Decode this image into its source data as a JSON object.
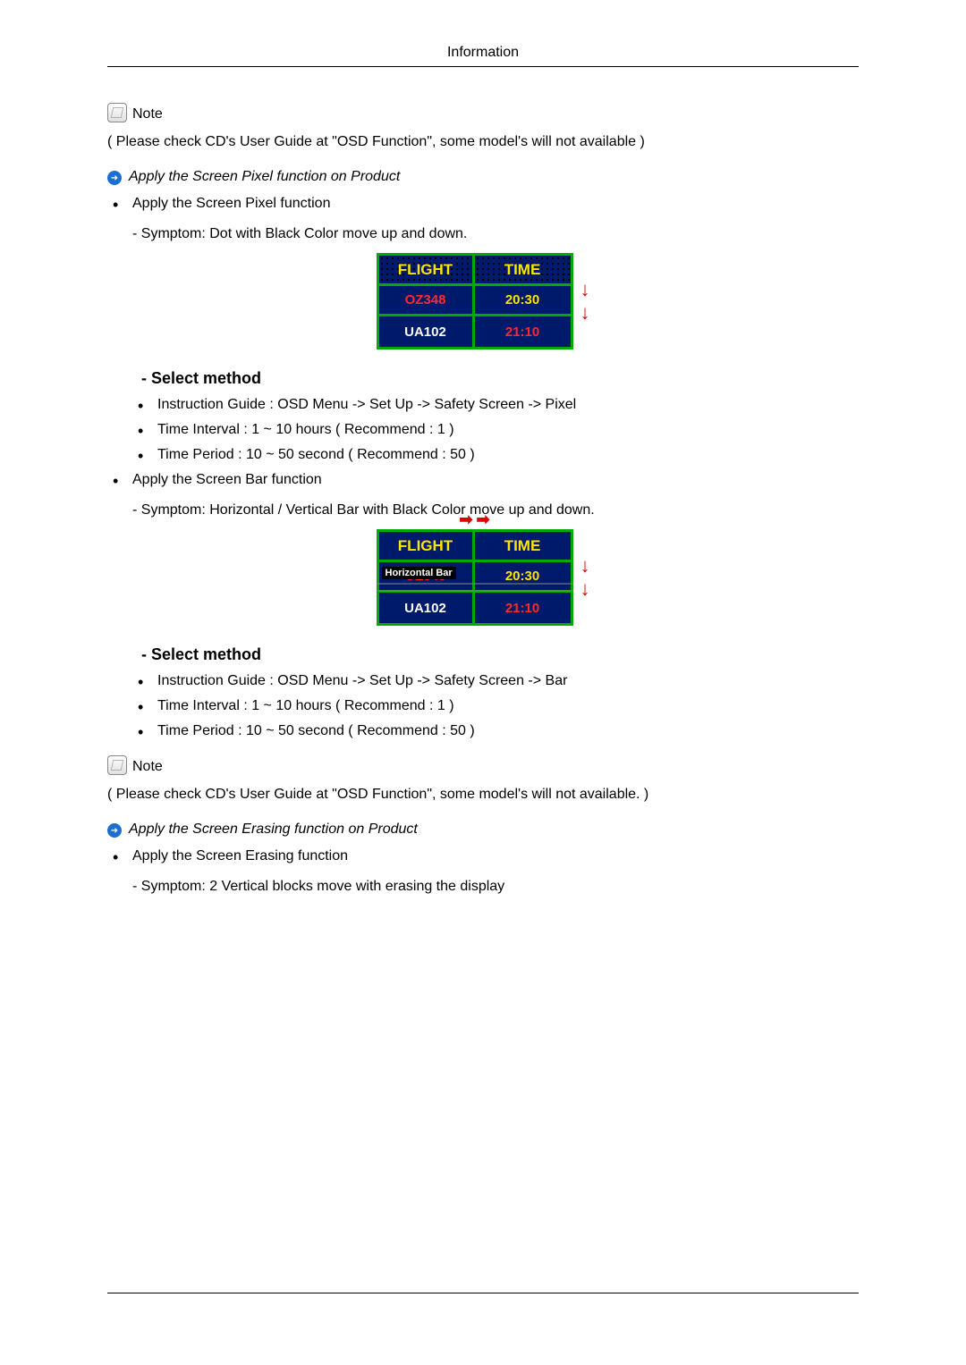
{
  "header": {
    "title": "Information"
  },
  "note1": {
    "label": "Note",
    "text": "( Please check CD's User Guide at \"OSD Function\", some model's will not available )"
  },
  "section_pixel": {
    "arrow_title": "Apply the Screen Pixel function on Product",
    "bullet": "Apply the Screen Pixel function",
    "symptom": "- Symptom: Dot with Black Color move up and down.",
    "select_method": "- Select method",
    "items": [
      "Instruction Guide : OSD Menu -> Set Up -> Safety Screen -> Pixel",
      "Time Interval : 1 ~ 10 hours ( Recommend : 1 )",
      "Time Period : 10 ~ 50 second ( Recommend : 50 )"
    ]
  },
  "section_bar": {
    "bullet": "Apply the Screen Bar function",
    "symptom": "- Symptom: Horizontal / Vertical Bar with Black Color move up and down.",
    "select_method": "- Select method",
    "items": [
      "Instruction Guide : OSD Menu -> Set Up -> Safety Screen -> Bar",
      "Time Interval : 1 ~ 10 hours ( Recommend : 1 )",
      "Time Period : 10 ~ 50 second ( Recommend : 50 )"
    ]
  },
  "note2": {
    "label": "Note",
    "text": "( Please check CD's User Guide at \"OSD Function\", some model's will not available. )"
  },
  "section_erase": {
    "arrow_title": "Apply the Screen Erasing function on Product",
    "bullet": "Apply the Screen Erasing function",
    "symptom": "- Symptom: 2 Vertical blocks move with erasing the display"
  },
  "flight_table": {
    "headers": [
      "FLIGHT",
      "TIME"
    ],
    "rows": [
      {
        "flight": "OZ348",
        "time": "20:30"
      },
      {
        "flight": "UA102",
        "time": "21:10"
      }
    ],
    "hbar_label": "Horizontal Bar"
  }
}
